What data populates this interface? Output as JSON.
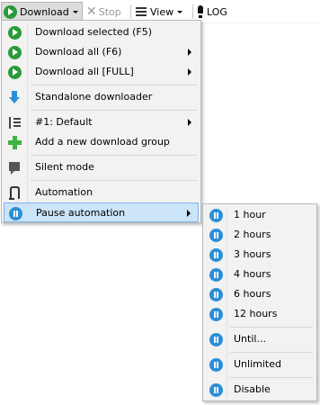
{
  "toolbar": {
    "download_label": "Download",
    "stop_label": "Stop",
    "view_label": "View",
    "log_label": "LOG"
  },
  "main_menu": {
    "items": [
      {
        "label": "Download selected (F5)",
        "icon": "play-icon",
        "submenu": false
      },
      {
        "label": "Download all (F6)",
        "icon": "play-icon",
        "submenu": true
      },
      {
        "label": "Download all [FULL]",
        "icon": "play-icon",
        "submenu": true
      },
      {
        "label": "Standalone downloader",
        "icon": "arrow-down-icon",
        "submenu": false
      },
      {
        "label": "#1: Default",
        "icon": "list-icon",
        "submenu": true
      },
      {
        "label": "Add a new download group",
        "icon": "plus-icon",
        "submenu": false
      },
      {
        "label": "Silent mode",
        "icon": "speech-bubble-icon",
        "submenu": false
      },
      {
        "label": "Automation",
        "icon": "automation-icon",
        "submenu": false
      },
      {
        "label": "Pause automation",
        "icon": "pause-icon",
        "submenu": true,
        "highlighted": true
      }
    ]
  },
  "pause_submenu": {
    "items": [
      {
        "label": "1 hour",
        "icon": "pause-icon"
      },
      {
        "label": "2 hours",
        "icon": "pause-icon"
      },
      {
        "label": "3 hours",
        "icon": "pause-icon"
      },
      {
        "label": "4 hours",
        "icon": "pause-icon"
      },
      {
        "label": "6 hours",
        "icon": "pause-icon"
      },
      {
        "label": "12 hours",
        "icon": "pause-icon"
      },
      {
        "label": "Until...",
        "icon": "pause-icon"
      },
      {
        "label": "Unlimited",
        "icon": "pause-icon"
      },
      {
        "label": "Disable",
        "icon": "pause-icon"
      }
    ]
  },
  "colors": {
    "play": "#2a9a3a",
    "pause": "#2b8fd6",
    "highlight": "#cce4f7",
    "highlight_border": "#7eb4ea",
    "menu_bg": "#f2f2f2"
  }
}
